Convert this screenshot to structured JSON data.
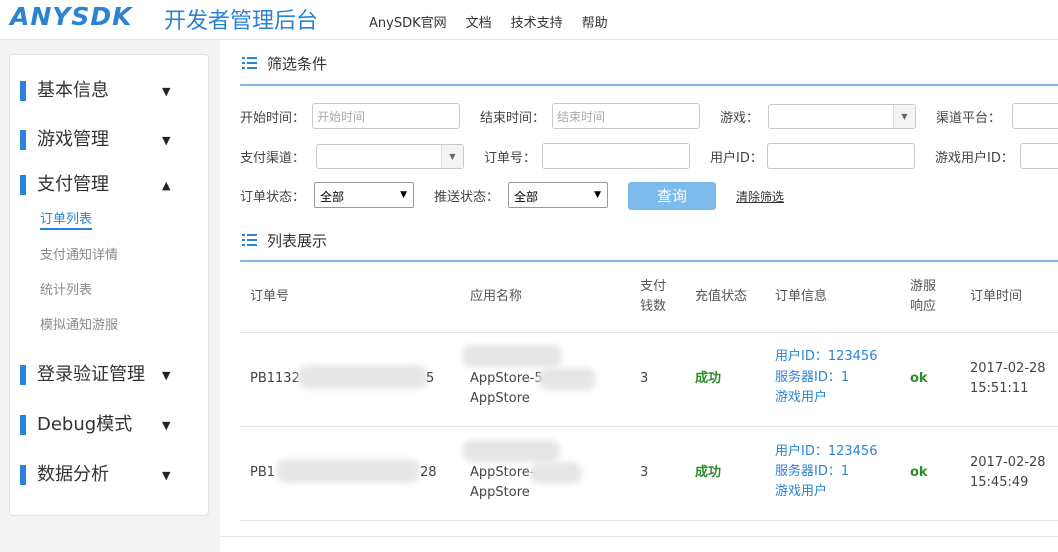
{
  "header": {
    "logo": "ANYSDK",
    "title": "开发者管理后台",
    "nav": [
      "AnySDK官网",
      "文档",
      "技术支持",
      "帮助"
    ]
  },
  "sidebar": {
    "menus": [
      {
        "label": "基本信息",
        "arrow": "▼"
      },
      {
        "label": "游戏管理",
        "arrow": "▼"
      },
      {
        "label": "支付管理",
        "arrow": "▲"
      },
      {
        "label": "登录验证管理",
        "arrow": "▼"
      },
      {
        "label": "Debug模式",
        "arrow": "▼"
      },
      {
        "label": "数据分析",
        "arrow": "▼"
      }
    ],
    "sub_items": [
      "订单列表",
      "支付通知详情",
      "统计列表",
      "模拟通知游服"
    ]
  },
  "filter": {
    "title": "筛选条件",
    "start_time_label": "开始时间：",
    "start_time_placeholder": "开始时间",
    "end_time_label": "结束时间：",
    "end_time_placeholder": "结束时间",
    "game_label": "游戏：",
    "channel_platform_label": "渠道平台：",
    "pay_channel_label": "支付渠道：",
    "order_no_label": "订单号：",
    "user_id_label": "用户ID：",
    "game_user_id_label": "游戏用户ID：",
    "order_status_label": "订单状态：",
    "order_status_value": "全部",
    "push_status_label": "推送状态：",
    "push_status_value": "全部",
    "query_button": "查询",
    "clear_link": "清除筛选"
  },
  "list": {
    "title": "列表展示",
    "headers": {
      "order_no": "订单号",
      "app_name": "应用名称",
      "amount_1": "支付",
      "amount_2": "钱数",
      "status": "充值状态",
      "order_info": "订单信息",
      "response_1": "游服",
      "response_2": "响应",
      "time": "订单时间"
    },
    "rows": [
      {
        "order_no_start": "PB1132",
        "order_no_end": "5",
        "app_line1": "AppStore-5",
        "app_line2": "AppStore",
        "amount": "3",
        "status": "成功",
        "user_id": "用户ID：123456",
        "server_id": "服务器ID：1",
        "game_user": "游戏用户",
        "response": "ok",
        "date": "2017-02-28",
        "time": "15:51:11"
      },
      {
        "order_no_start": "PB1",
        "order_no_end": "28",
        "app_line1": "AppStore-",
        "app_line2": "AppStore",
        "amount": "3",
        "status": "成功",
        "user_id": "用户ID：123456",
        "server_id": "服务器ID：1",
        "game_user": "游戏用户",
        "response": "ok",
        "date": "2017-02-28",
        "time": "15:45:49"
      }
    ]
  },
  "colors": {
    "accent": "#2b83d6",
    "button": "#7cbbec",
    "success": "#2e8b2e"
  }
}
